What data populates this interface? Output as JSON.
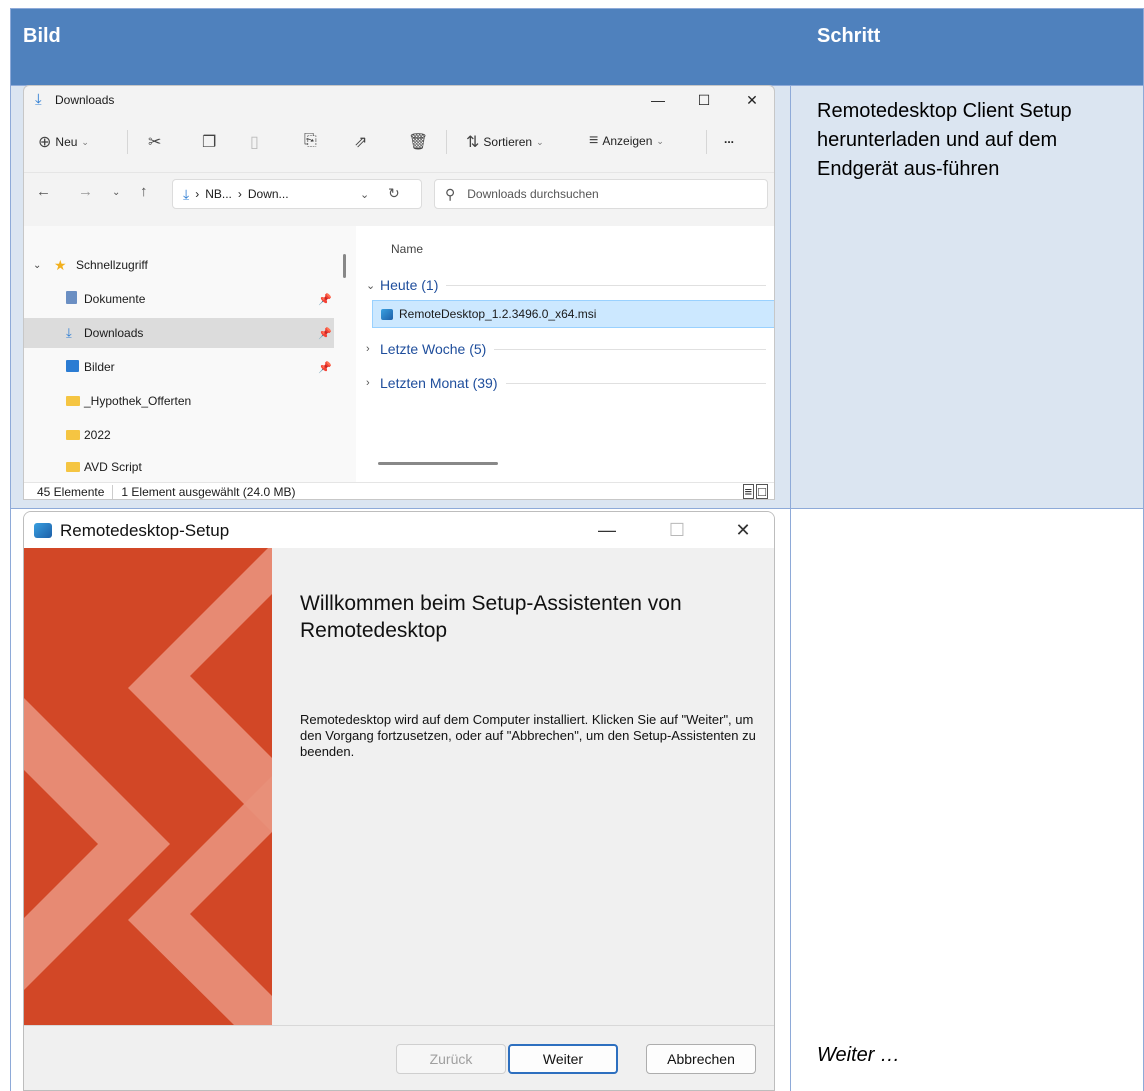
{
  "table": {
    "header_left": "Bild",
    "header_right": "Schritt",
    "step1_text": "Remotedesktop Client Setup herunterladen und auf dem Endgerät aus-führen",
    "step2_text": "Weiter …"
  },
  "explorer": {
    "title": "Downloads",
    "toolbar": {
      "new_label": "Neu",
      "sort_label": "Sortieren",
      "view_label": "Anzeigen",
      "more_label": "..."
    },
    "address": {
      "path_root": "NB...",
      "path_current": "Down...",
      "search_placeholder": "Downloads durchsuchen"
    },
    "nav": {
      "quick_access": "Schnellzugriff",
      "items": [
        {
          "label": "Dokumente"
        },
        {
          "label": "Downloads"
        },
        {
          "label": "Bilder"
        },
        {
          "label": "_Hypothek_Offerten"
        },
        {
          "label": "2022"
        },
        {
          "label": "AVD Script"
        }
      ]
    },
    "files": {
      "column_name": "Name",
      "groups": [
        {
          "label": "Heute (1)"
        },
        {
          "label": "Letzte Woche (5)"
        },
        {
          "label": "Letzten Monat (39)"
        }
      ],
      "selected_file": "RemoteDesktop_1.2.3496.0_x64.msi"
    },
    "status": {
      "count": "45 Elemente",
      "selection": "1 Element ausgewählt (24.0 MB)"
    }
  },
  "setup": {
    "title": "Remotedesktop-Setup",
    "welcome": "Willkommen beim Setup-Assistenten von Remotedesktop",
    "description": "Remotedesktop wird auf dem Computer installiert. Klicken Sie auf \"Weiter\", um den Vorgang fortzusetzen, oder auf \"Abbrechen\", um den Setup-Assistenten zu beenden.",
    "buttons": {
      "back": "Zurück",
      "next": "Weiter",
      "cancel": "Abbrechen"
    },
    "colors": {
      "banner": "#d24726",
      "chevrons": "#e8907a"
    }
  }
}
